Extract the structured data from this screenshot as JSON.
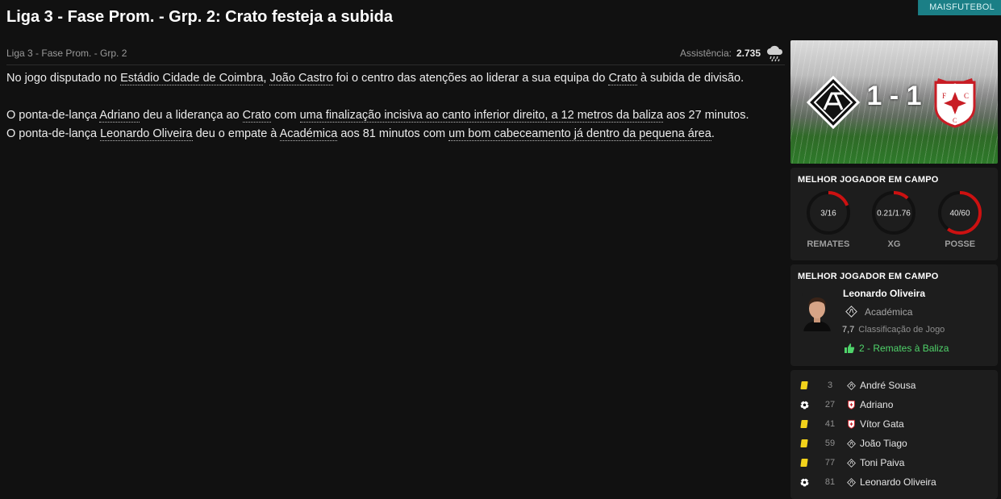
{
  "headline": "Liga 3 - Fase Prom. - Grp. 2: Crato festeja a subida",
  "tag": "MAISFUTEBOL",
  "competition": "Liga 3 - Fase Prom. - Grp. 2",
  "attendance": {
    "label": "Assistência:",
    "value": "2.735",
    "weather_icon": "rain-cloud-icon"
  },
  "article": {
    "p1": [
      {
        "t": "No jogo disputado no "
      },
      {
        "t": "Estádio Cidade de Coimbra",
        "link": true
      },
      {
        "t": ", "
      },
      {
        "t": "João Castro",
        "link": true
      },
      {
        "t": " foi o centro das atenções ao liderar a sua equipa do "
      },
      {
        "t": "Crato",
        "link": true
      },
      {
        "t": " à subida de divisão."
      }
    ],
    "p2": [
      {
        "t": "O ponta-de-lança "
      },
      {
        "t": "Adriano",
        "link": true
      },
      {
        "t": " deu a liderança ao "
      },
      {
        "t": "Crato",
        "link": true
      },
      {
        "t": " com "
      },
      {
        "t": "uma finalização incisiva ao canto inferior direito, a 12 metros da baliza",
        "link": true
      },
      {
        "t": " aos 27 minutos."
      }
    ],
    "p3": [
      {
        "t": "O ponta-de-lança "
      },
      {
        "t": "Leonardo Oliveira",
        "link": true
      },
      {
        "t": " deu o empate à "
      },
      {
        "t": "Académica",
        "link": true
      },
      {
        "t": " aos 81 minutos com "
      },
      {
        "t": "um bom cabeceamento já dentro da pequena área",
        "link": true
      },
      {
        "t": "."
      }
    ]
  },
  "score": {
    "text": "1 - 1",
    "home_icon": "academica-crest-icon",
    "away_icon": "crato-crest-icon"
  },
  "stats_panel": {
    "title": "MELHOR JOGADOR EM CAMPO",
    "items": [
      {
        "label": "REMATES",
        "text": "3/16",
        "fraction": 0.19,
        "color": "#cc1111"
      },
      {
        "label": "XG",
        "text": "0.21/1.76",
        "fraction": 0.12,
        "color": "#cc1111"
      },
      {
        "label": "POSSE",
        "text": "40/60",
        "fraction": 0.6,
        "color": "#cc1111"
      }
    ]
  },
  "potm": {
    "title": "MELHOR JOGADOR EM CAMPO",
    "name": "Leonardo Oliveira",
    "club": "Académica",
    "rating": "7,7",
    "rating_label": "Classificação de Jogo",
    "highlight": "2 - Remates à Baliza"
  },
  "events": [
    {
      "type": "yellow-card",
      "minute": "3",
      "club": "academica",
      "player": "André Sousa"
    },
    {
      "type": "goal",
      "minute": "27",
      "club": "crato",
      "player": "Adriano"
    },
    {
      "type": "yellow-card",
      "minute": "41",
      "club": "crato",
      "player": "Vítor Gata"
    },
    {
      "type": "yellow-card",
      "minute": "59",
      "club": "academica",
      "player": "João Tiago"
    },
    {
      "type": "yellow-card",
      "minute": "77",
      "club": "academica",
      "player": "Toni Paiva"
    },
    {
      "type": "goal",
      "minute": "81",
      "club": "academica",
      "player": "Leonardo Oliveira"
    }
  ],
  "colors": {
    "accent": "#1b7f86",
    "ring": "#cc1111",
    "positive": "#4fd36a",
    "card": "#f2d21b"
  }
}
